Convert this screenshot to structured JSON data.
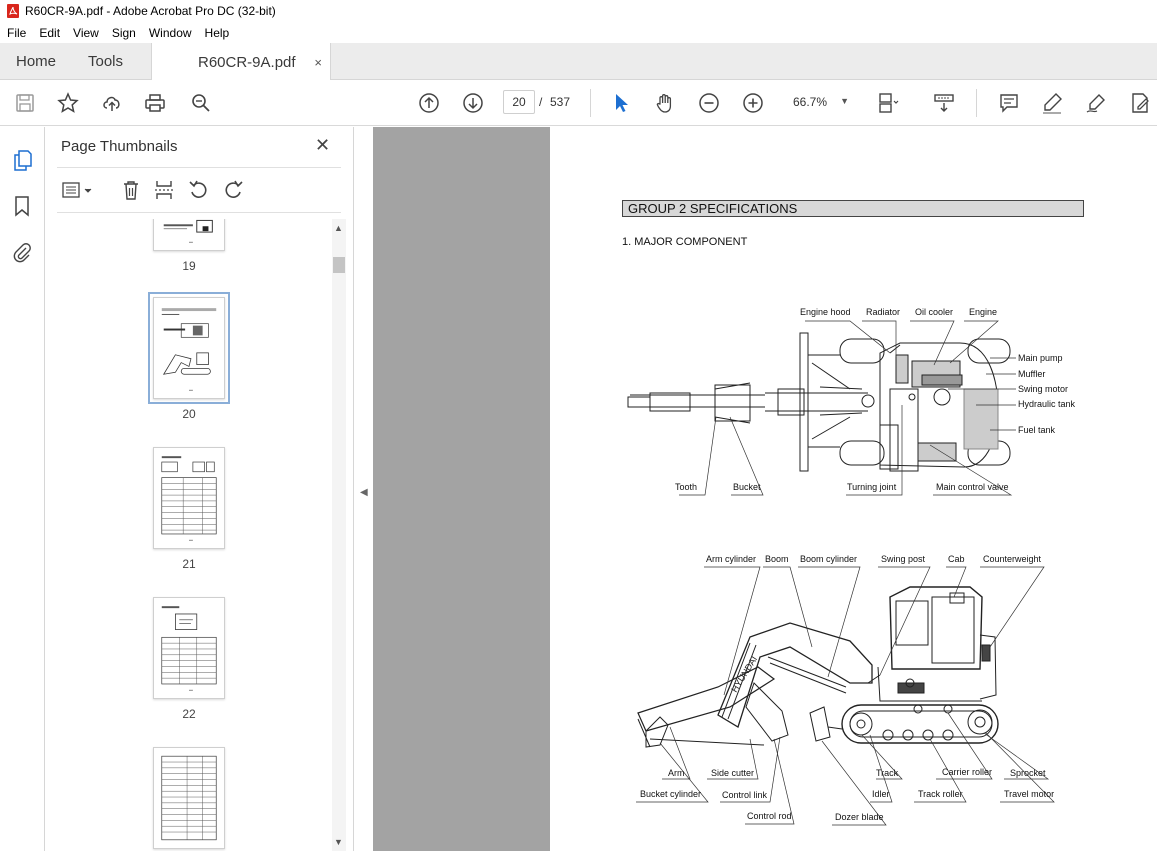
{
  "window": {
    "title": "R60CR-9A.pdf - Adobe Acrobat Pro DC (32-bit)"
  },
  "menu": [
    "File",
    "Edit",
    "View",
    "Sign",
    "Window",
    "Help"
  ],
  "tabs": {
    "home": "Home",
    "tools": "Tools",
    "doc": "R60CR-9A.pdf",
    "close": "×"
  },
  "toolbar": {
    "page_current": "20",
    "page_sep": "/",
    "page_total": "537",
    "zoom": "66.7%"
  },
  "panel": {
    "title": "Page Thumbnails",
    "close": "✕",
    "thumbs": [
      "19",
      "20",
      "21",
      "22"
    ]
  },
  "doc": {
    "group_title": "GROUP  2  SPECIFICATIONS",
    "section": "1.  MAJOR COMPONENT",
    "top_labels": {
      "engine_hood": "Engine hood",
      "radiator": "Radiator",
      "oil_cooler": "Oil cooler",
      "engine": "Engine",
      "main_pump": "Main pump",
      "muffler": "Muffler",
      "swing_motor": "Swing motor",
      "hydraulic_tank": "Hydraulic tank",
      "fuel_tank": "Fuel tank",
      "tooth": "Tooth",
      "bucket": "Bucket",
      "turning_joint": "Turning joint",
      "main_control_valve": "Main control valve"
    },
    "side_labels": {
      "arm_cylinder": "Arm cylinder",
      "boom": "Boom",
      "boom_cylinder": "Boom cylinder",
      "swing_post": "Swing post",
      "cab": "Cab",
      "counterweight": "Counterweight",
      "arm": "Arm",
      "side_cutter": "Side cutter",
      "bucket_cylinder": "Bucket cylinder",
      "control_link": "Control link",
      "control_rod": "Control rod",
      "dozer_blade": "Dozer blade",
      "track": "Track",
      "idler": "Idler",
      "track_roller": "Track roller",
      "carrier_roller": "Carrier roller",
      "sprocket": "Sprocket",
      "travel_motor": "Travel motor",
      "brand": "HYUNDAI"
    }
  }
}
